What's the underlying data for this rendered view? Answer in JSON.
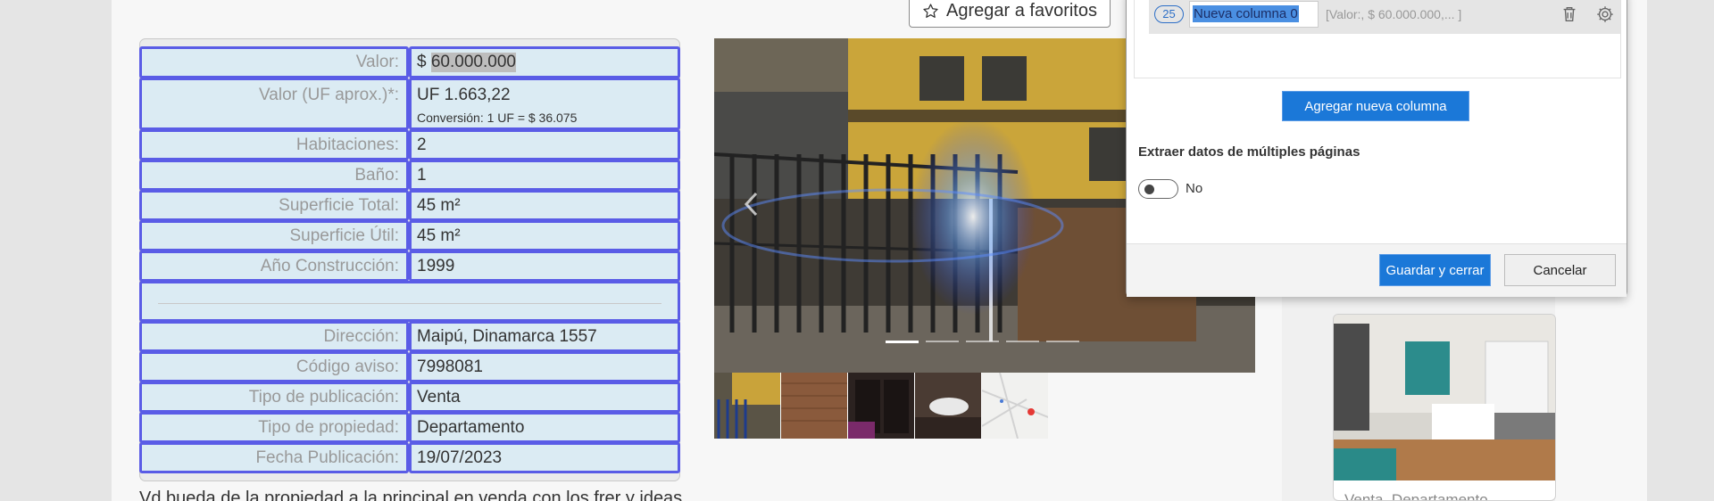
{
  "header": {
    "favorite_button": "Agregar a favoritos"
  },
  "details": {
    "valor_label": "Valor:",
    "valor_currency": "$",
    "valor_value": "60.000.000",
    "uf_label": "Valor (UF aprox.)*:",
    "uf_value": "UF 1.663,22",
    "uf_conversion": "Conversión: 1 UF = $ 36.075",
    "rows": [
      {
        "label": "Habitaciones:",
        "value": "2"
      },
      {
        "label": "Baño:",
        "value": "1"
      },
      {
        "label": "Superficie Total:",
        "value": "45 m²"
      },
      {
        "label": "Superficie Útil:",
        "value": "45 m²"
      },
      {
        "label": "Año Construcción:",
        "value": "1999"
      }
    ],
    "rows2": [
      {
        "label": "Dirección:",
        "value": "Maipú, Dinamarca 1557"
      },
      {
        "label": "Código aviso:",
        "value": "7998081"
      },
      {
        "label": "Tipo de publicación:",
        "value": "Venta"
      },
      {
        "label": "Tipo de propiedad:",
        "value": "Departamento"
      },
      {
        "label": "Fecha Publicación:",
        "value": "19/07/2023"
      }
    ]
  },
  "gallery": {
    "thumbnails": [
      "building-front",
      "brick-wall",
      "wardrobe",
      "bathroom-sink",
      "map"
    ],
    "slides": 5,
    "active_slide": 1
  },
  "description_snippet": "Vd bueda de la propiedad a la principal en venda con los frer y ideas",
  "listing_card": {
    "caption": "Venta, Departamento"
  },
  "dialog": {
    "column_badge": "25",
    "column_name": "Nueva columna 0",
    "column_preview": "[Valor:, $ 60.000.000,... ]",
    "add_column_button": "Agregar nueva columna",
    "multi_page_title": "Extraer datos de múltiples páginas",
    "multi_page_toggle_label": "No",
    "multi_page_enabled": false,
    "save_button": "Guardar y cerrar",
    "cancel_button": "Cancelar"
  },
  "colors": {
    "row_border": "#5a5ce6",
    "row_bg": "#dbebf3",
    "accent_blue": "#1b78d8"
  }
}
